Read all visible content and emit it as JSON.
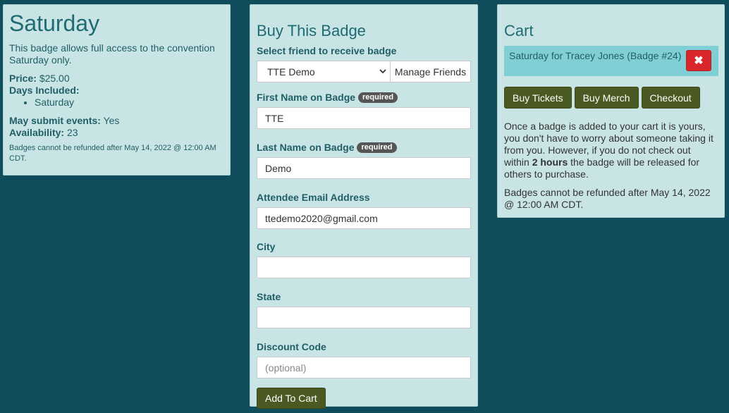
{
  "badge_info": {
    "title": "Saturday",
    "description": "This badge allows full access to the convention Saturday only.",
    "price_label": "Price:",
    "price_value": "$25.00",
    "days_label": "Days Included:",
    "days": [
      "Saturday"
    ],
    "submit_events_label": "May submit events:",
    "submit_events_value": "Yes",
    "availability_label": "Availability:",
    "availability_value": "23",
    "refund_note": "Badges cannot be refunded after May 14, 2022 @ 12:00 AM CDT."
  },
  "buy_form": {
    "title": "Buy This Badge",
    "friend_label": "Select friend to receive badge",
    "friend_selected": "TTE Demo",
    "manage_friends_label": "Manage Friends",
    "required_badge": "required",
    "first_name_label": "First Name on Badge",
    "first_name_value": "TTE",
    "last_name_label": "Last Name on Badge",
    "last_name_value": "Demo",
    "email_label": "Attendee Email Address",
    "email_value": "ttedemo2020@gmail.com",
    "city_label": "City",
    "city_value": "",
    "state_label": "State",
    "state_value": "",
    "discount_label": "Discount Code",
    "discount_placeholder": "(optional)",
    "add_to_cart_label": "Add To Cart"
  },
  "cart": {
    "title": "Cart",
    "item_text": "Saturday for Tracey Jones (Badge #24)",
    "remove_icon": "✖",
    "buy_tickets_label": "Buy Tickets",
    "buy_merch_label": "Buy Merch",
    "checkout_label": "Checkout",
    "notice_part1": "Once a badge is added to your cart it is yours, you don't have to worry about someone taking it from you. However, if you do not check out within ",
    "notice_bold": "2 hours",
    "notice_part2": " the badge will be released for others to purchase.",
    "refund_note": "Badges cannot be refunded after May 14, 2022 @ 12:00 AM CDT."
  },
  "colors": {
    "background": "#0f4c5c",
    "panel": "#c9e4e5",
    "heading": "#1f6b73",
    "dark_button": "#4a5a22",
    "cart_item": "#80cfd4",
    "remove_button": "#d9262b"
  }
}
